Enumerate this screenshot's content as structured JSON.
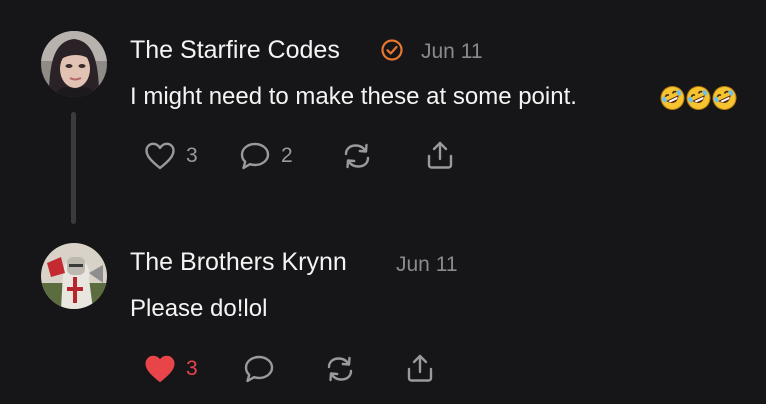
{
  "comments": [
    {
      "author": "The Starfire Codes",
      "verified": true,
      "date": "Jun 11",
      "text": "I might need to make these at some point.",
      "emojis": [
        "rolling-on-floor-laughing",
        "rolling-on-floor-laughing",
        "rolling-on-floor-laughing"
      ],
      "likes": "3",
      "liked": false,
      "replies": "2"
    },
    {
      "author": "The Brothers Krynn",
      "verified": false,
      "date": "Jun 11",
      "text": "Please do!lol",
      "likes": "3",
      "liked": true
    }
  ],
  "colors": {
    "background": "#161618",
    "verified_badge": "#e8772e",
    "liked_heart": "#e8454a",
    "icon": "#9a9a9e"
  },
  "icons": {
    "like": "heart-icon",
    "comment": "speech-bubble-icon",
    "restack": "restack-arrows-icon",
    "share": "share-upload-icon",
    "verified": "verified-check-icon"
  }
}
